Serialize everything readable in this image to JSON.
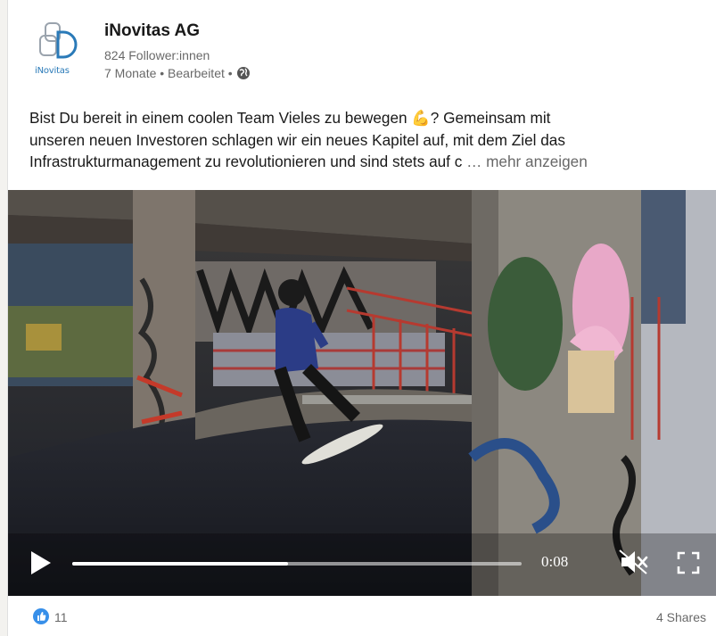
{
  "post": {
    "author": {
      "name": "iNovitas AG",
      "followers": "824 Follower:innen",
      "meta": "7 Monate • Bearbeitet •",
      "logo_text": "iNovitas"
    },
    "text_lines": [
      "Bist Du bereit in einem coolen Team Vieles zu bewegen 💪? Gemeinsam mit",
      "unseren neuen Investoren schlagen wir ein neues Kapitel auf, mit dem Ziel das",
      "Infrastrukturmanagement zu revolutionieren und sind stets auf c"
    ],
    "see_more": "… mehr anzeigen",
    "video": {
      "time": "0:08",
      "progress": 0.48
    },
    "reactions": {
      "count": "11",
      "shares": "4 Shares"
    }
  },
  "colors": {
    "accent": "#0a66c2",
    "logo": "#2a7ab8",
    "secondary_text": "#666666"
  }
}
